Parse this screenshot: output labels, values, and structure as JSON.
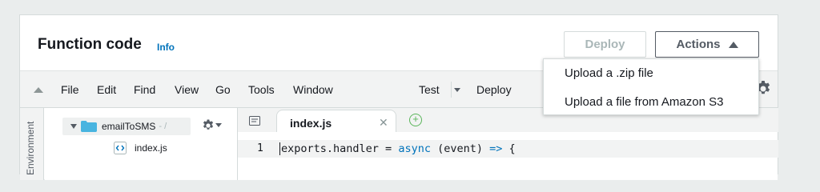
{
  "header": {
    "title": "Function code",
    "info_label": "Info",
    "deploy_label": "Deploy",
    "actions_label": "Actions"
  },
  "actions_menu": {
    "items": [
      "Upload a .zip file",
      "Upload a file from Amazon S3"
    ]
  },
  "menubar": {
    "items": [
      "File",
      "Edit",
      "Find",
      "View",
      "Go",
      "Tools",
      "Window"
    ],
    "test_label": "Test",
    "deploy_label": "Deploy"
  },
  "environment": {
    "label": "Environment",
    "folder_name": "emailToSMS",
    "folder_path": "- /",
    "file_name": "index.js"
  },
  "editor": {
    "tab_label": "index.js",
    "line_number": "1",
    "code": {
      "part1": "exports.handler = ",
      "keyword": "async",
      "part2": " (event) ",
      "arrow": "=>",
      "part3": " {"
    }
  },
  "colors": {
    "link": "#0073bb",
    "folder": "#48b4e0",
    "add_tab": "#5ab55a"
  }
}
